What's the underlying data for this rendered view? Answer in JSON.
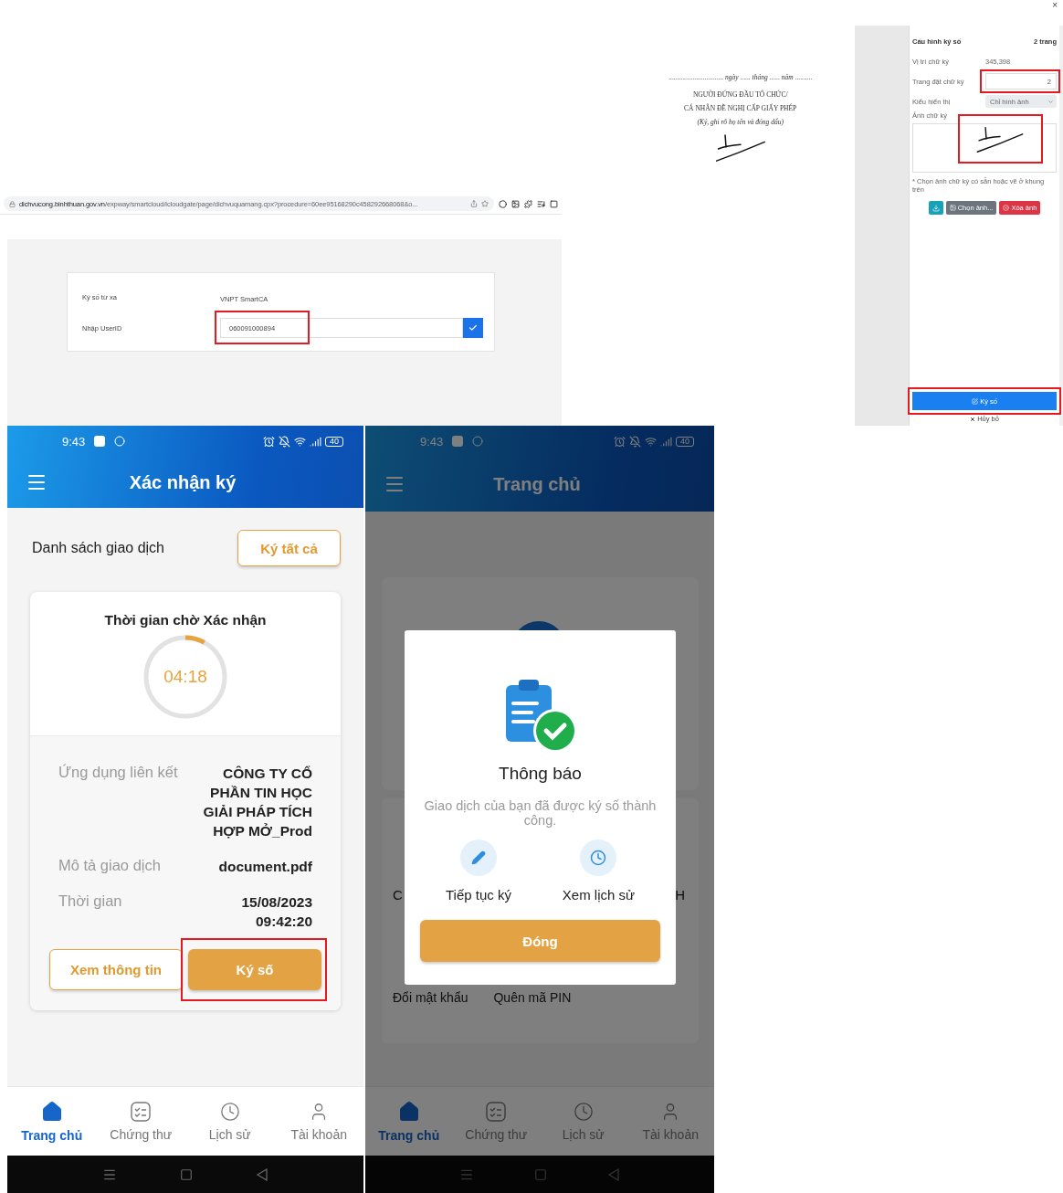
{
  "browser": {
    "url_host": "dichvucong.binhthuan.gov.vn",
    "url_path": "/expway/smartcloud/icloudgate/page/dichvuquamang.cpx?procedure=60ee95168290c458292668068&o..."
  },
  "remote_sign_form": {
    "rows": [
      {
        "kind": "text",
        "label": "Ký số từ xa",
        "value": "VNPT SmartCA",
        "highlighted": false
      },
      {
        "kind": "input",
        "label": "Nhập UserID",
        "value": "060091000894",
        "highlighted": true
      }
    ]
  },
  "document": {
    "date_line": "................................ *ngày* ...... *tháng* ...... *năm* ..........",
    "lines": [
      "NGƯỜI ĐỨNG ĐẦU TỔ CHỨC/",
      "CÁ NHÂN ĐỀ NGHỊ CẤP GIẤY PHÉP"
    ],
    "note": "(Ký, ghi rõ họ tên và đóng dấu)"
  },
  "close_label": "×",
  "signature_config": {
    "title": "Cấu hình ký số",
    "page_count": "2 trang",
    "fields": [
      {
        "kind": "text",
        "label": "Vị trí chữ ký",
        "value": "345,398",
        "highlighted": false
      },
      {
        "kind": "input",
        "label": "Trang đặt chữ ký",
        "value": "2",
        "highlighted": true
      },
      {
        "kind": "select",
        "label": "Kiểu hiển thị",
        "value": "Chỉ hình ảnh",
        "highlighted": false
      }
    ],
    "image_label": "Ảnh chữ ký",
    "image_highlighted": true,
    "hint": "* Chọn ảnh chữ ký có sẵn hoặc vẽ ở khung trên",
    "buttons": [
      {
        "kind": "download"
      },
      {
        "kind": "choose",
        "label": "Chọn ảnh..."
      },
      {
        "kind": "delete",
        "label": "Xóa ảnh"
      }
    ],
    "sign_button": {
      "label": "Ký số",
      "highlighted": true
    },
    "cancel_button": "Hủy bỏ"
  },
  "confirm_screen": {
    "status": {
      "time": "9:43",
      "battery": "40"
    },
    "title": "Xác nhận ký",
    "list_title": "Danh sách giao dịch",
    "sign_all": "Ký tất cả",
    "timer": {
      "title": "Thời gian chờ Xác nhận",
      "value": "04:18",
      "level": 0.08
    },
    "details": [
      {
        "label": "Ứng dụng liên kết",
        "value": "CÔNG TY CỔ PHẦN TIN HỌC GIẢI PHÁP TÍCH HỢP MỞ_Prod"
      },
      {
        "label": "Mô tả giao dịch",
        "value": "document.pdf"
      },
      {
        "label": "Thời gian",
        "value": "15/08/2023 09:42:20"
      }
    ],
    "actions": [
      {
        "kind": "outline",
        "label": "Xem thông tin",
        "highlighted": false
      },
      {
        "kind": "filled",
        "label": "Ký số",
        "highlighted": true
      }
    ],
    "nav": [
      {
        "kind": "home",
        "label": "Trang chủ",
        "selected": true
      },
      {
        "kind": "certificate",
        "label": "Chứng thư",
        "selected": false
      },
      {
        "kind": "history",
        "label": "Lịch sử",
        "selected": false
      },
      {
        "kind": "account",
        "label": "Tài khoản",
        "selected": false
      }
    ]
  },
  "home_screen": {
    "status": {
      "time": "9:43",
      "battery": "40"
    },
    "title": "Trang chủ",
    "background_texts": {
      "left": "C",
      "right": "H",
      "links": [
        "Đổi mật khẩu",
        "Quên mã PIN"
      ]
    },
    "dialog": {
      "title": "Thông báo",
      "message": "Giao dịch của bạn đã được ký số thành công.",
      "options": [
        {
          "kind": "edit",
          "label": "Tiếp tục ký"
        },
        {
          "kind": "history",
          "label": "Xem lịch sử"
        }
      ],
      "close_button": "Đóng"
    },
    "nav": [
      {
        "kind": "home",
        "label": "Trang chủ",
        "selected": true
      },
      {
        "kind": "certificate",
        "label": "Chứng thư",
        "selected": false
      },
      {
        "kind": "history",
        "label": "Lịch sử",
        "selected": false
      },
      {
        "kind": "account",
        "label": "Tài khoản",
        "selected": false
      }
    ]
  }
}
